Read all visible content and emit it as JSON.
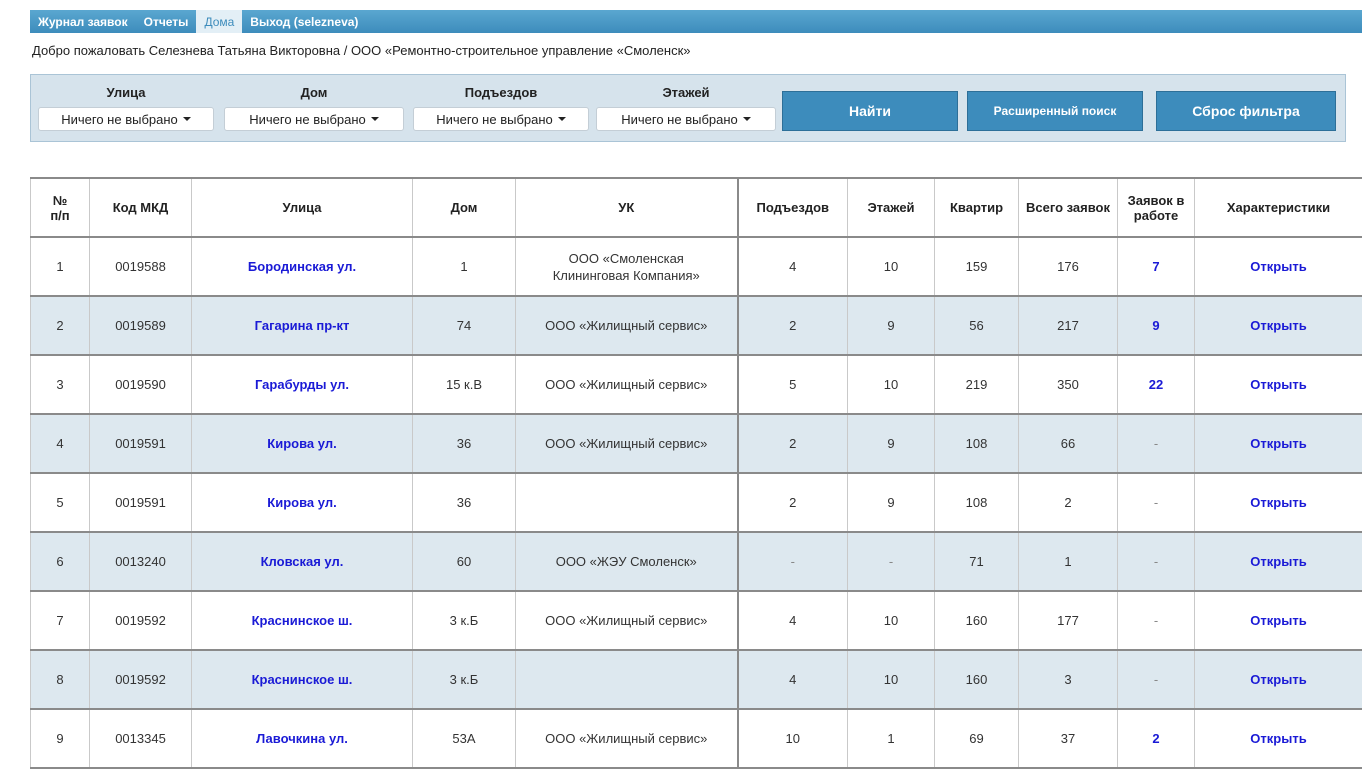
{
  "nav": {
    "items": [
      "Журнал заявок",
      "Отчеты",
      "Дома",
      "Выход (selezneva)"
    ],
    "active_index": 2
  },
  "welcome": "Добро пожаловать Селезнева Татьяна Викторовна / ООО «Ремонтно-строительное управление «Смоленск»",
  "filters": {
    "street": {
      "label": "Улица",
      "value": "Ничего не выбрано"
    },
    "house": {
      "label": "Дом",
      "value": "Ничего не выбрано"
    },
    "entrances": {
      "label": "Подъездов",
      "value": "Ничего не выбрано"
    },
    "floors": {
      "label": "Этажей",
      "value": "Ничего не выбрано"
    },
    "find_button": "Найти",
    "advanced_button": "Расширенный поиск",
    "reset_button": "Сброс фильтра"
  },
  "table": {
    "headers": {
      "num": "№\nп/п",
      "code": "Код МКД",
      "street": "Улица",
      "house": "Дом",
      "uk": "УК",
      "entrances": "Подъездов",
      "floors": "Этажей",
      "apartments": "Квартир",
      "total": "Всего заявок",
      "in_work": "Заявок в работе",
      "characteristics": "Характеристики"
    },
    "rows": [
      {
        "num": "1",
        "code": "0019588",
        "street": "Бородинская ул.",
        "house": "1",
        "uk": "ООО «Смоленская Клининговая Компания»",
        "entrances": "4",
        "floors": "10",
        "apartments": "159",
        "total": "176",
        "in_work": "7",
        "action": "Открыть"
      },
      {
        "num": "2",
        "code": "0019589",
        "street": "Гагарина пр-кт",
        "house": "74",
        "uk": "ООО «Жилищный сервис»",
        "entrances": "2",
        "floors": "9",
        "apartments": "56",
        "total": "217",
        "in_work": "9",
        "action": "Открыть"
      },
      {
        "num": "3",
        "code": "0019590",
        "street": "Гарабурды ул.",
        "house": "15 к.В",
        "uk": "ООО «Жилищный сервис»",
        "entrances": "5",
        "floors": "10",
        "apartments": "219",
        "total": "350",
        "in_work": "22",
        "action": "Открыть"
      },
      {
        "num": "4",
        "code": "0019591",
        "street": "Кирова ул.",
        "house": "36",
        "uk": "ООО «Жилищный сервис»",
        "entrances": "2",
        "floors": "9",
        "apartments": "108",
        "total": "66",
        "in_work": "-",
        "action": "Открыть"
      },
      {
        "num": "5",
        "code": "0019591",
        "street": "Кирова ул.",
        "house": "36",
        "uk": "",
        "entrances": "2",
        "floors": "9",
        "apartments": "108",
        "total": "2",
        "in_work": "-",
        "action": "Открыть"
      },
      {
        "num": "6",
        "code": "0013240",
        "street": "Кловская ул.",
        "house": "60",
        "uk": "ООО «ЖЭУ Смоленск»",
        "entrances": "-",
        "floors": "-",
        "apartments": "71",
        "total": "1",
        "in_work": "-",
        "action": "Открыть"
      },
      {
        "num": "7",
        "code": "0019592",
        "street": "Краснинское ш.",
        "house": "3 к.Б",
        "uk": "ООО «Жилищный сервис»",
        "entrances": "4",
        "floors": "10",
        "apartments": "160",
        "total": "177",
        "in_work": "-",
        "action": "Открыть"
      },
      {
        "num": "8",
        "code": "0019592",
        "street": "Краснинское ш.",
        "house": "3 к.Б",
        "uk": "",
        "entrances": "4",
        "floors": "10",
        "apartments": "160",
        "total": "3",
        "in_work": "-",
        "action": "Открыть"
      },
      {
        "num": "9",
        "code": "0013345",
        "street": "Лавочкина ул.",
        "house": "53А",
        "uk": "ООО «Жилищный сервис»",
        "entrances": "10",
        "floors": "1",
        "apartments": "69",
        "total": "37",
        "in_work": "2",
        "action": "Открыть"
      }
    ]
  }
}
